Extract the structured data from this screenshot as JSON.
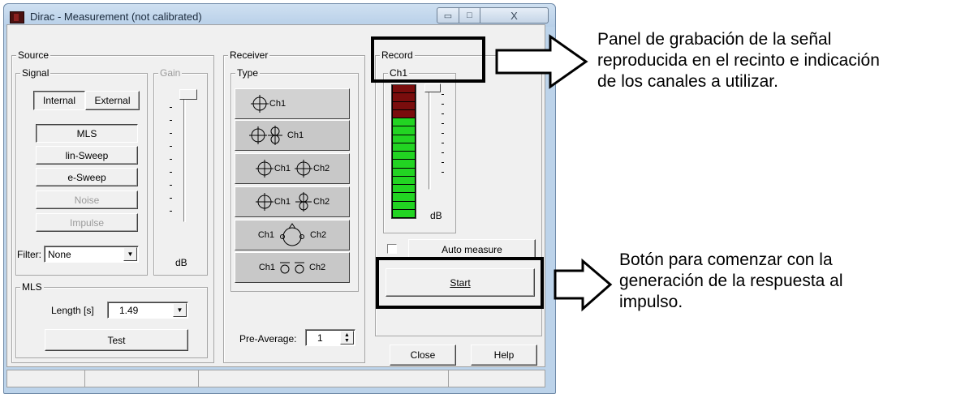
{
  "window": {
    "title": "Dirac - Measurement (not calibrated)",
    "min_glyph": "▭",
    "max_glyph": "□",
    "close_glyph": "X"
  },
  "source": {
    "group_label": "Source",
    "signal_label": "Signal",
    "gain_label": "Gain",
    "tab_internal": "Internal",
    "tab_external": "External",
    "buttons": [
      "MLS",
      "lin-Sweep",
      "e-Sweep",
      "Noise",
      "Impulse"
    ],
    "filter_label": "Filter:",
    "filter_value": "None",
    "gain_unit": "dB"
  },
  "mls": {
    "group_label": "MLS",
    "length_label": "Length [s]",
    "length_value": "1.49",
    "test_label": "Test"
  },
  "receiver": {
    "group_label": "Receiver",
    "type_label": "Type",
    "types": [
      {
        "label": "Ch1",
        "label2": "",
        "icon": "omni-mic-icon"
      },
      {
        "label": "Ch1",
        "label2": "",
        "icon": "omni-figure8-mic-icon"
      },
      {
        "label": "Ch1",
        "label2": "Ch2",
        "icon": "stereo-omni-mic-icon"
      },
      {
        "label": "Ch1",
        "label2": "Ch2",
        "icon": "omni-figure8-pair-icon"
      },
      {
        "label": "Ch1",
        "label2": "Ch2",
        "icon": "dummy-head-icon"
      },
      {
        "label": "Ch1",
        "label2": "Ch2",
        "icon": "binaural-ear-icon"
      }
    ],
    "preaverage_label": "Pre-Average:",
    "preaverage_value": "1"
  },
  "record": {
    "group_label": "Record",
    "channel_label": "Ch1",
    "meter_unit": "dB",
    "meter_red_segments": 4,
    "meter_green_segments": 12,
    "auto_measure_label": "Auto measure",
    "auto_measure_checked": false,
    "start_label": "Start",
    "close_label": "Close",
    "help_label": "Help"
  },
  "annotations": {
    "record_panel_text": [
      "Panel de grabación de la señal",
      "reproducida en el recinto e indicación",
      "de los canales a utilizar."
    ],
    "start_button_text": [
      "Botón para comenzar con la",
      "generación de la respuesta al",
      "impulso."
    ]
  },
  "colors": {
    "meter_red": "#7a0d0d",
    "meter_green": "#22d422",
    "window_frame": "#bcd3ea"
  }
}
